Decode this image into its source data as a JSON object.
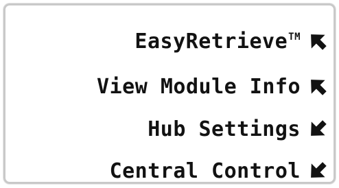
{
  "menu": {
    "items": [
      {
        "label": "EasyRetrieve",
        "trademark": "TM",
        "arrow": "arrow-up-right-icon"
      },
      {
        "label": "View Module Info",
        "arrow": "arrow-up-right-icon"
      },
      {
        "label": "Hub Settings",
        "arrow": "arrow-down-right-icon"
      },
      {
        "label": "Central Control",
        "arrow": "arrow-down-right-icon"
      }
    ]
  },
  "colors": {
    "text": "#121212",
    "border": "#c9c9c9",
    "background": "#ffffff"
  }
}
